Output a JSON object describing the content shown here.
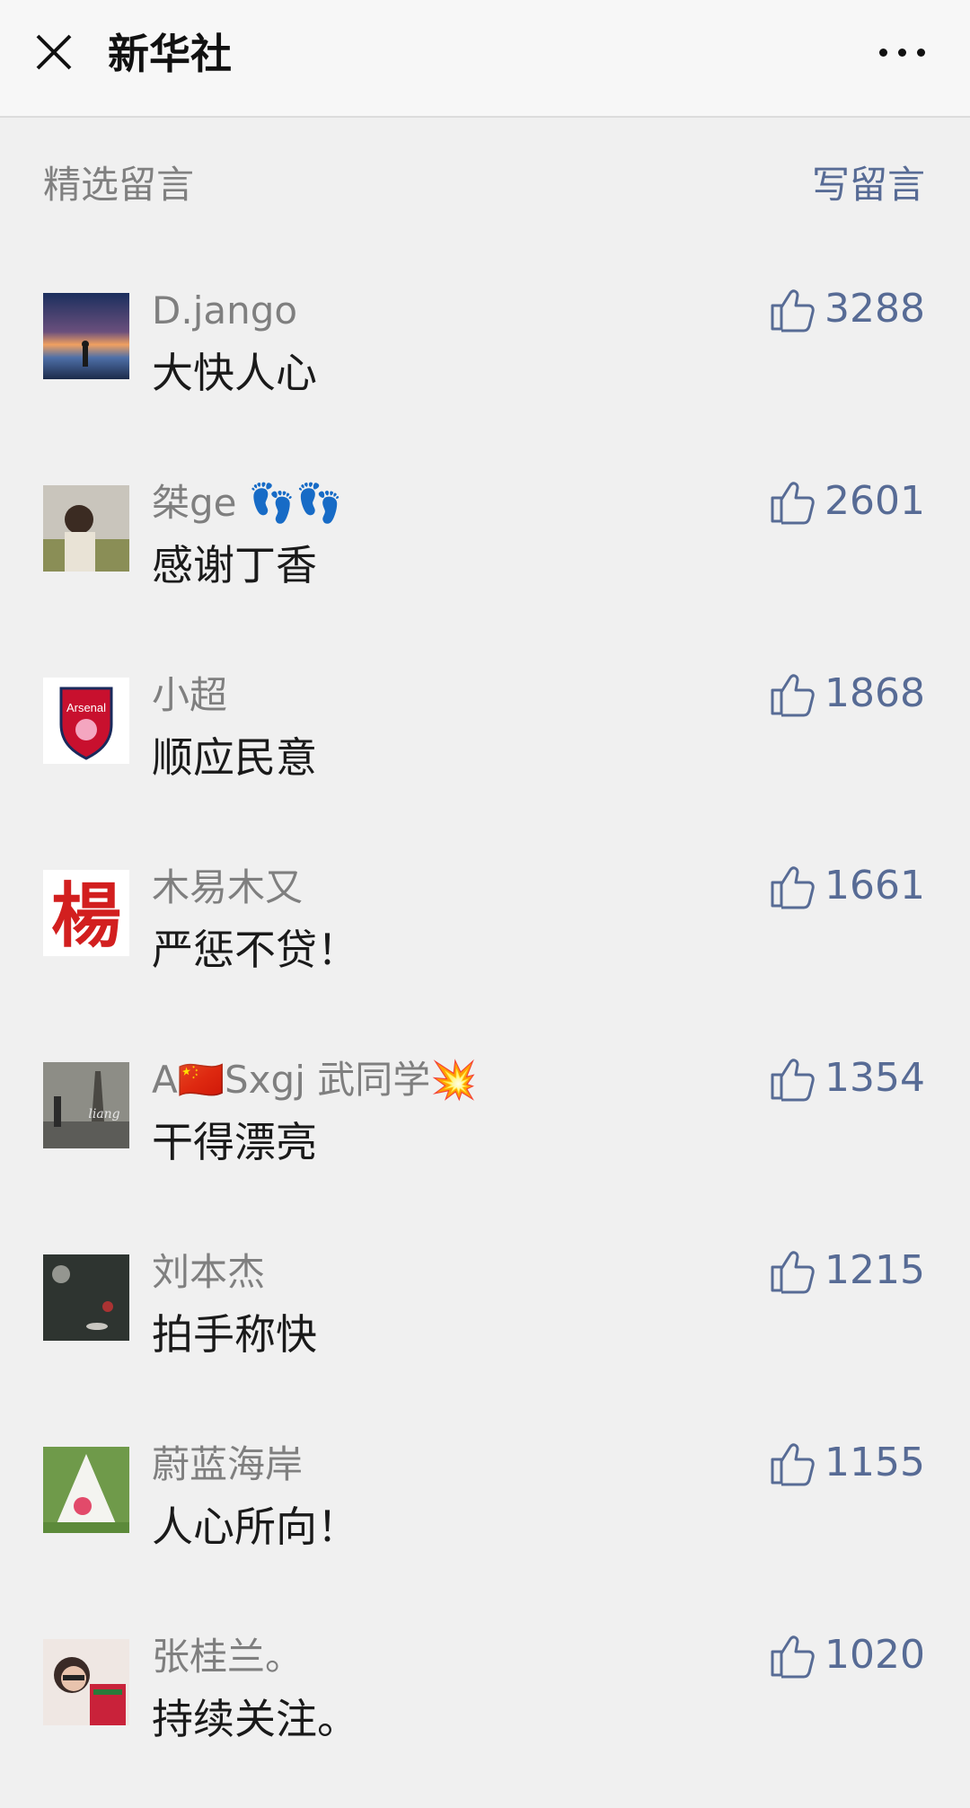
{
  "header": {
    "title": "新华社",
    "close_icon": "close-icon",
    "more_icon": "more-icon"
  },
  "section": {
    "title": "精选留言",
    "write_label": "写留言"
  },
  "comments": [
    {
      "nickname": "D.jango",
      "text": "大快人心",
      "likes": "3288"
    },
    {
      "nickname": "桀ge 👣👣",
      "text": "感谢丁香",
      "likes": "2601"
    },
    {
      "nickname": "小超",
      "text": "顺应民意",
      "likes": "1868"
    },
    {
      "nickname": "木易木又",
      "text": "严惩不贷！",
      "likes": "1661"
    },
    {
      "nickname": "A🇨🇳Sxgj 武同学💥",
      "text": "干得漂亮",
      "likes": "1354"
    },
    {
      "nickname": "刘本杰",
      "text": "拍手称快",
      "likes": "1215"
    },
    {
      "nickname": "蔚蓝海岸",
      "text": "人心所向！",
      "likes": "1155"
    },
    {
      "nickname": "张桂兰。",
      "text": "持续关注。",
      "likes": "1020"
    }
  ],
  "avatar_images": {
    "arsenal_badge_text": "Arsenal",
    "yang_seal_text": "楊",
    "pagoda_photo_text": "liang"
  },
  "colors": {
    "link": "#576b95",
    "nickname": "#7f7f7f",
    "text": "#1a1a1a",
    "background": "#f0f0f0"
  }
}
